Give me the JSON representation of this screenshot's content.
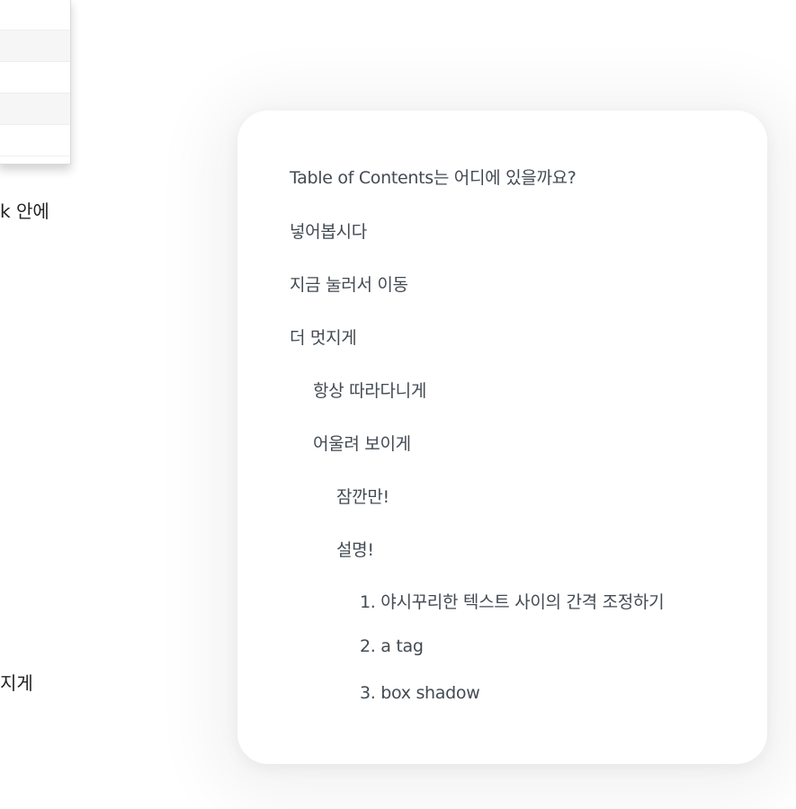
{
  "left_text": {
    "line1": "k 안에",
    "line2": "지게"
  },
  "toc": {
    "items": [
      {
        "label": "Table of Contents는 어디에 있을까요?",
        "level": 1
      },
      {
        "label": "넣어봅시다",
        "level": 1
      },
      {
        "label": "지금 눌러서 이동",
        "level": 1
      },
      {
        "label": "더 멋지게",
        "level": 1
      },
      {
        "label": "항상 따라다니게",
        "level": 2
      },
      {
        "label": "어울려 보이게",
        "level": 2
      },
      {
        "label": "잠깐만!",
        "level": 3
      },
      {
        "label": "설명!",
        "level": 3
      },
      {
        "label": "1. 야시꾸리한 텍스트 사이의 간격 조정하기",
        "level": 4
      },
      {
        "label": "2. a tag",
        "level": 4
      },
      {
        "label": "3. box shadow",
        "level": 4
      }
    ]
  }
}
